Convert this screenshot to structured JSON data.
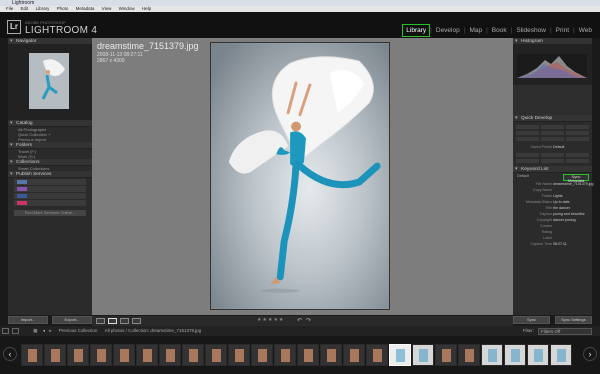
{
  "window": {
    "title": "Lightroom"
  },
  "menu": [
    "File",
    "Edit",
    "Library",
    "Photo",
    "Metadata",
    "View",
    "Window",
    "Help"
  ],
  "identity": {
    "adobe_text": "ADOBE PHOTOSHOP",
    "app_name": "LIGHTROOM 4",
    "logo_text": "Lr"
  },
  "modules": [
    "Library",
    "Develop",
    "Map",
    "Book",
    "Slideshow",
    "Print",
    "Web"
  ],
  "active_module": "Library",
  "left_panel": {
    "navigator_header": "Navigator",
    "catalog_header": "Catalog",
    "catalog_rows": [
      "All Photographs",
      "Quick Collection +",
      "Previous Import"
    ],
    "folders_header": "Folders",
    "folder_rows": [
      "Travel (F:)",
      "Work (G:)"
    ],
    "collections_header": "Collections",
    "collection_rows": [
      "Smart Collections"
    ],
    "publish_header": "Publish Services",
    "publish_button": "Find More Services Online...",
    "import_button": "Import...",
    "export_button": "Export..."
  },
  "photo": {
    "filename": "dreamstime_7151379.jpg",
    "date": "2008-11-13 08:27:11",
    "dimensions": "2867 x 4300"
  },
  "toolbar": {
    "stars": "★★★★★"
  },
  "right_panel": {
    "histogram_header": "Histogram",
    "quick_develop_header": "Quick Develop",
    "saved_preset_label": "Saved Preset",
    "saved_preset_value": "Default",
    "keyword_list_header": "Keyword List",
    "sync_button": "Sync Metadata",
    "metadata_preset": "Default",
    "meta_rows": [
      {
        "k": "File Name",
        "v": "dreamstime_7151379.jpg"
      },
      {
        "k": "Copy Name",
        "v": ""
      },
      {
        "k": "Folder",
        "v": "Lights"
      },
      {
        "k": "Metadata Status",
        "v": "Up to date"
      },
      {
        "k": "Title",
        "v": "the dancer"
      },
      {
        "k": "Caption",
        "v": "young and beautiful dancer posing"
      },
      {
        "k": "Copyright",
        "v": ""
      },
      {
        "k": "Creator",
        "v": ""
      },
      {
        "k": "Rating",
        "v": ""
      },
      {
        "k": "Label",
        "v": ""
      },
      {
        "k": "Capture Time",
        "v": "08:27:11"
      }
    ],
    "sync_btn": "Sync",
    "sync_settings_btn": "Sync Settings"
  },
  "filmbar": {
    "source_label": "Previous Collection",
    "selection_text": "All photos / Collection: dreamstime_7151379.jpg",
    "filter_label": "Filter:",
    "filter_value": "Filters Off"
  }
}
